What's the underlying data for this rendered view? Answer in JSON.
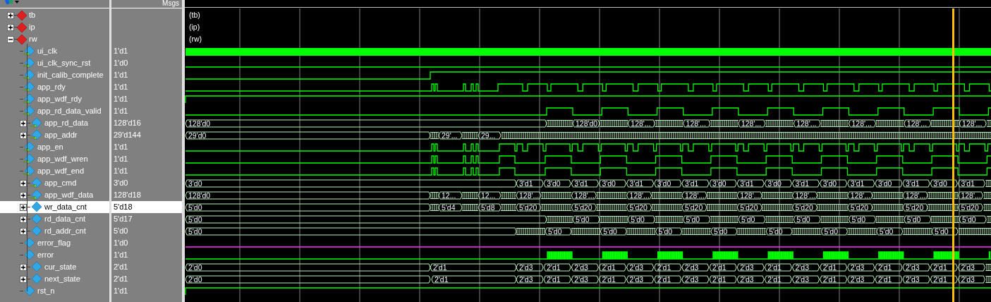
{
  "header": {
    "value_column_title": "Msgs"
  },
  "groups": [
    {
      "name": "tb",
      "expanded": false,
      "wave_label": "(tb)"
    },
    {
      "name": "ip",
      "expanded": false,
      "wave_label": "(ip)"
    },
    {
      "name": "rw",
      "expanded": true,
      "wave_label": "(rw)",
      "children": [
        {
          "name": "ui_clk",
          "value": "1'd1",
          "kind": "bit",
          "port": true,
          "selected": false
        },
        {
          "name": "ui_clk_sync_rst",
          "value": "1'd0",
          "kind": "bit",
          "port": true,
          "selected": false
        },
        {
          "name": "init_calib_complete",
          "value": "1'd1",
          "kind": "bit",
          "port": true,
          "selected": false
        },
        {
          "name": "app_rdy",
          "value": "1'd1",
          "kind": "bit",
          "port": true,
          "selected": false
        },
        {
          "name": "app_wdf_rdy",
          "value": "1'd1",
          "kind": "bit",
          "port": true,
          "selected": false
        },
        {
          "name": "app_rd_data_valid",
          "value": "1'd1",
          "kind": "bit",
          "port": true,
          "selected": false
        },
        {
          "name": "app_rd_data",
          "value": "128'd16",
          "kind": "bus",
          "port": true,
          "expanded": false,
          "selected": false,
          "segments": [
            "128'd0",
            "128'd0",
            "128'...",
            "128'...",
            "128'...",
            "128'...",
            "128'...",
            "128'...",
            "128'..."
          ]
        },
        {
          "name": "app_addr",
          "value": "29'd144",
          "kind": "bus",
          "port": true,
          "expanded": false,
          "selected": false,
          "segments": [
            "29'd0",
            "29'...",
            "29..."
          ]
        },
        {
          "name": "app_en",
          "value": "1'd1",
          "kind": "bit",
          "port": true,
          "selected": false
        },
        {
          "name": "app_wdf_wren",
          "value": "1'd1",
          "kind": "bit",
          "port": true,
          "selected": false
        },
        {
          "name": "app_wdf_end",
          "value": "1'd1",
          "kind": "bit",
          "port": true,
          "selected": false
        },
        {
          "name": "app_cmd",
          "value": "3'd0",
          "kind": "bus",
          "port": true,
          "expanded": false,
          "selected": false,
          "segments": [
            "3'd0",
            "3'd1",
            "3'd0",
            "3'd1",
            "3'd0",
            "3'd1",
            "3'd0",
            "3'd1",
            "3'd0",
            "3'd1",
            "3'd0",
            "3'd1",
            "3'd0",
            "3'd1",
            "3'd0",
            "3'd1",
            "3'd0",
            "3'd1"
          ]
        },
        {
          "name": "app_wdf_data",
          "value": "128'd18",
          "kind": "bus",
          "port": true,
          "expanded": false,
          "selected": false,
          "segments": [
            "128'd0",
            "12...",
            "12...",
            "128'...",
            "128'...",
            "128'...",
            "128'...",
            "128'...",
            "128'...",
            "128'...",
            "128'...",
            "128'..."
          ]
        },
        {
          "name": "wr_data_cnt",
          "value": "5'd18",
          "kind": "bus",
          "port": false,
          "expanded": false,
          "selected": true,
          "segments": [
            "5'd0",
            "5'd4",
            "5'd8",
            "5'd20",
            "5'd20",
            "5'd20",
            "5'd20",
            "5'd20",
            "5'd20",
            "5'd20",
            "5'd20",
            "5'd20"
          ]
        },
        {
          "name": "rd_data_cnt",
          "value": "5'd17",
          "kind": "bus",
          "port": false,
          "expanded": false,
          "selected": false,
          "segments": [
            "5'd0",
            "5'd0",
            "5'd0",
            "5'd0",
            "5'd0",
            "5'd0",
            "5'd0",
            "5'd0",
            "5'd0"
          ]
        },
        {
          "name": "rd_addr_cnt",
          "value": "5'd0",
          "kind": "bus",
          "port": false,
          "expanded": false,
          "selected": false,
          "segments": [
            "5'd0",
            "5'd0",
            "5'd0",
            "5'd0",
            "5'd0",
            "5'd0",
            "5'd0",
            "5'd0",
            "5'd0"
          ]
        },
        {
          "name": "error_flag",
          "value": "1'd0",
          "kind": "bit",
          "port": false,
          "selected": false
        },
        {
          "name": "error",
          "value": "1'd1",
          "kind": "bit",
          "port": false,
          "selected": false
        },
        {
          "name": "cur_state",
          "value": "2'd1",
          "kind": "bus",
          "port": false,
          "expanded": false,
          "selected": false,
          "segments": [
            "2'd0",
            "2'd1",
            "2'd3",
            "2'd1",
            "2'd3",
            "2'd1",
            "2'd3",
            "2'd1",
            "2'd3",
            "2'd1",
            "2'd3",
            "2'd1",
            "2'd3",
            "2'd1",
            "2'd3",
            "2'd1",
            "2'd3",
            "2'd1",
            "2'd3"
          ]
        },
        {
          "name": "next_state",
          "value": "2'd1",
          "kind": "bus",
          "port": false,
          "expanded": false,
          "selected": false,
          "segments": [
            "2'd0",
            "2'd1",
            "2'd3",
            "2'd1",
            "2'd3",
            "2'd1",
            "2'd3",
            "2'd1",
            "2'd3",
            "2'd1",
            "2'd3",
            "2'd1",
            "2'd3",
            "2'd1",
            "2'd3",
            "2'd1",
            "2'd3",
            "2'd1",
            "2'd3"
          ]
        },
        {
          "name": "rst_n",
          "value": "1'd1",
          "kind": "bit",
          "port": false,
          "selected": false
        }
      ]
    }
  ]
}
